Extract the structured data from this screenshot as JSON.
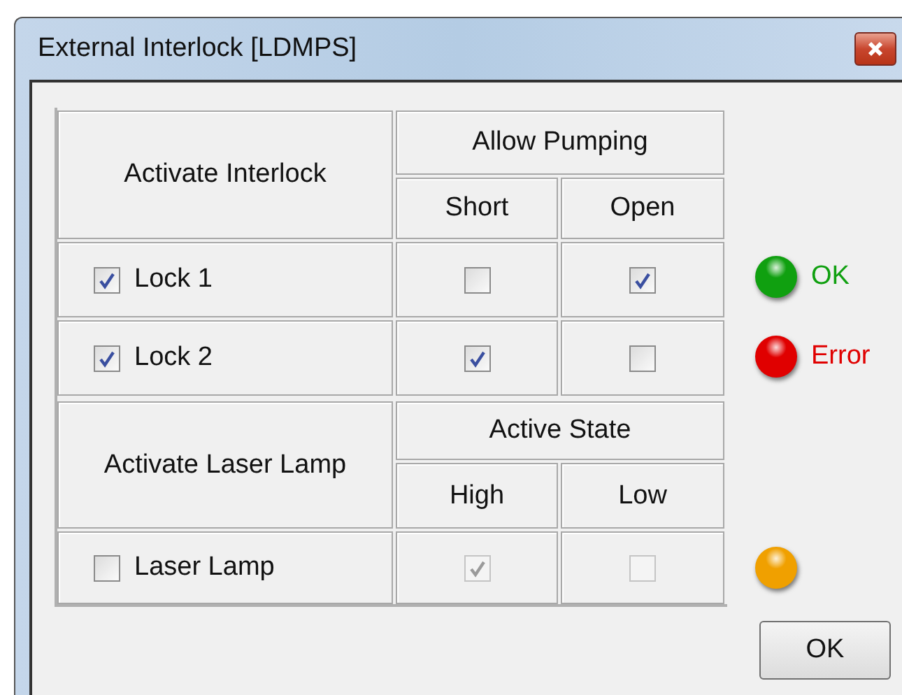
{
  "window": {
    "title": "External Interlock [LDMPS]"
  },
  "sections": [
    {
      "heading": "Activate Interlock",
      "group_heading": "Allow Pumping",
      "columns": [
        "Short",
        "Open"
      ],
      "rows": [
        {
          "label": "Lock 1",
          "checked": true,
          "options": [
            {
              "checked": false,
              "disabled": false
            },
            {
              "checked": true,
              "disabled": false
            }
          ],
          "indicator": {
            "color": "#10a010",
            "text": "OK"
          }
        },
        {
          "label": "Lock 2",
          "checked": true,
          "options": [
            {
              "checked": true,
              "disabled": false
            },
            {
              "checked": false,
              "disabled": false
            }
          ],
          "indicator": {
            "color": "#e00000",
            "text": "Error"
          }
        }
      ]
    },
    {
      "heading": "Activate Laser Lamp",
      "group_heading": "Active State",
      "columns": [
        "High",
        "Low"
      ],
      "rows": [
        {
          "label": "Laser Lamp",
          "checked": false,
          "options": [
            {
              "checked": true,
              "disabled": true
            },
            {
              "checked": false,
              "disabled": true
            }
          ],
          "indicator": {
            "color": "#f0a000"
          }
        }
      ]
    }
  ],
  "buttons": [
    "OK"
  ]
}
